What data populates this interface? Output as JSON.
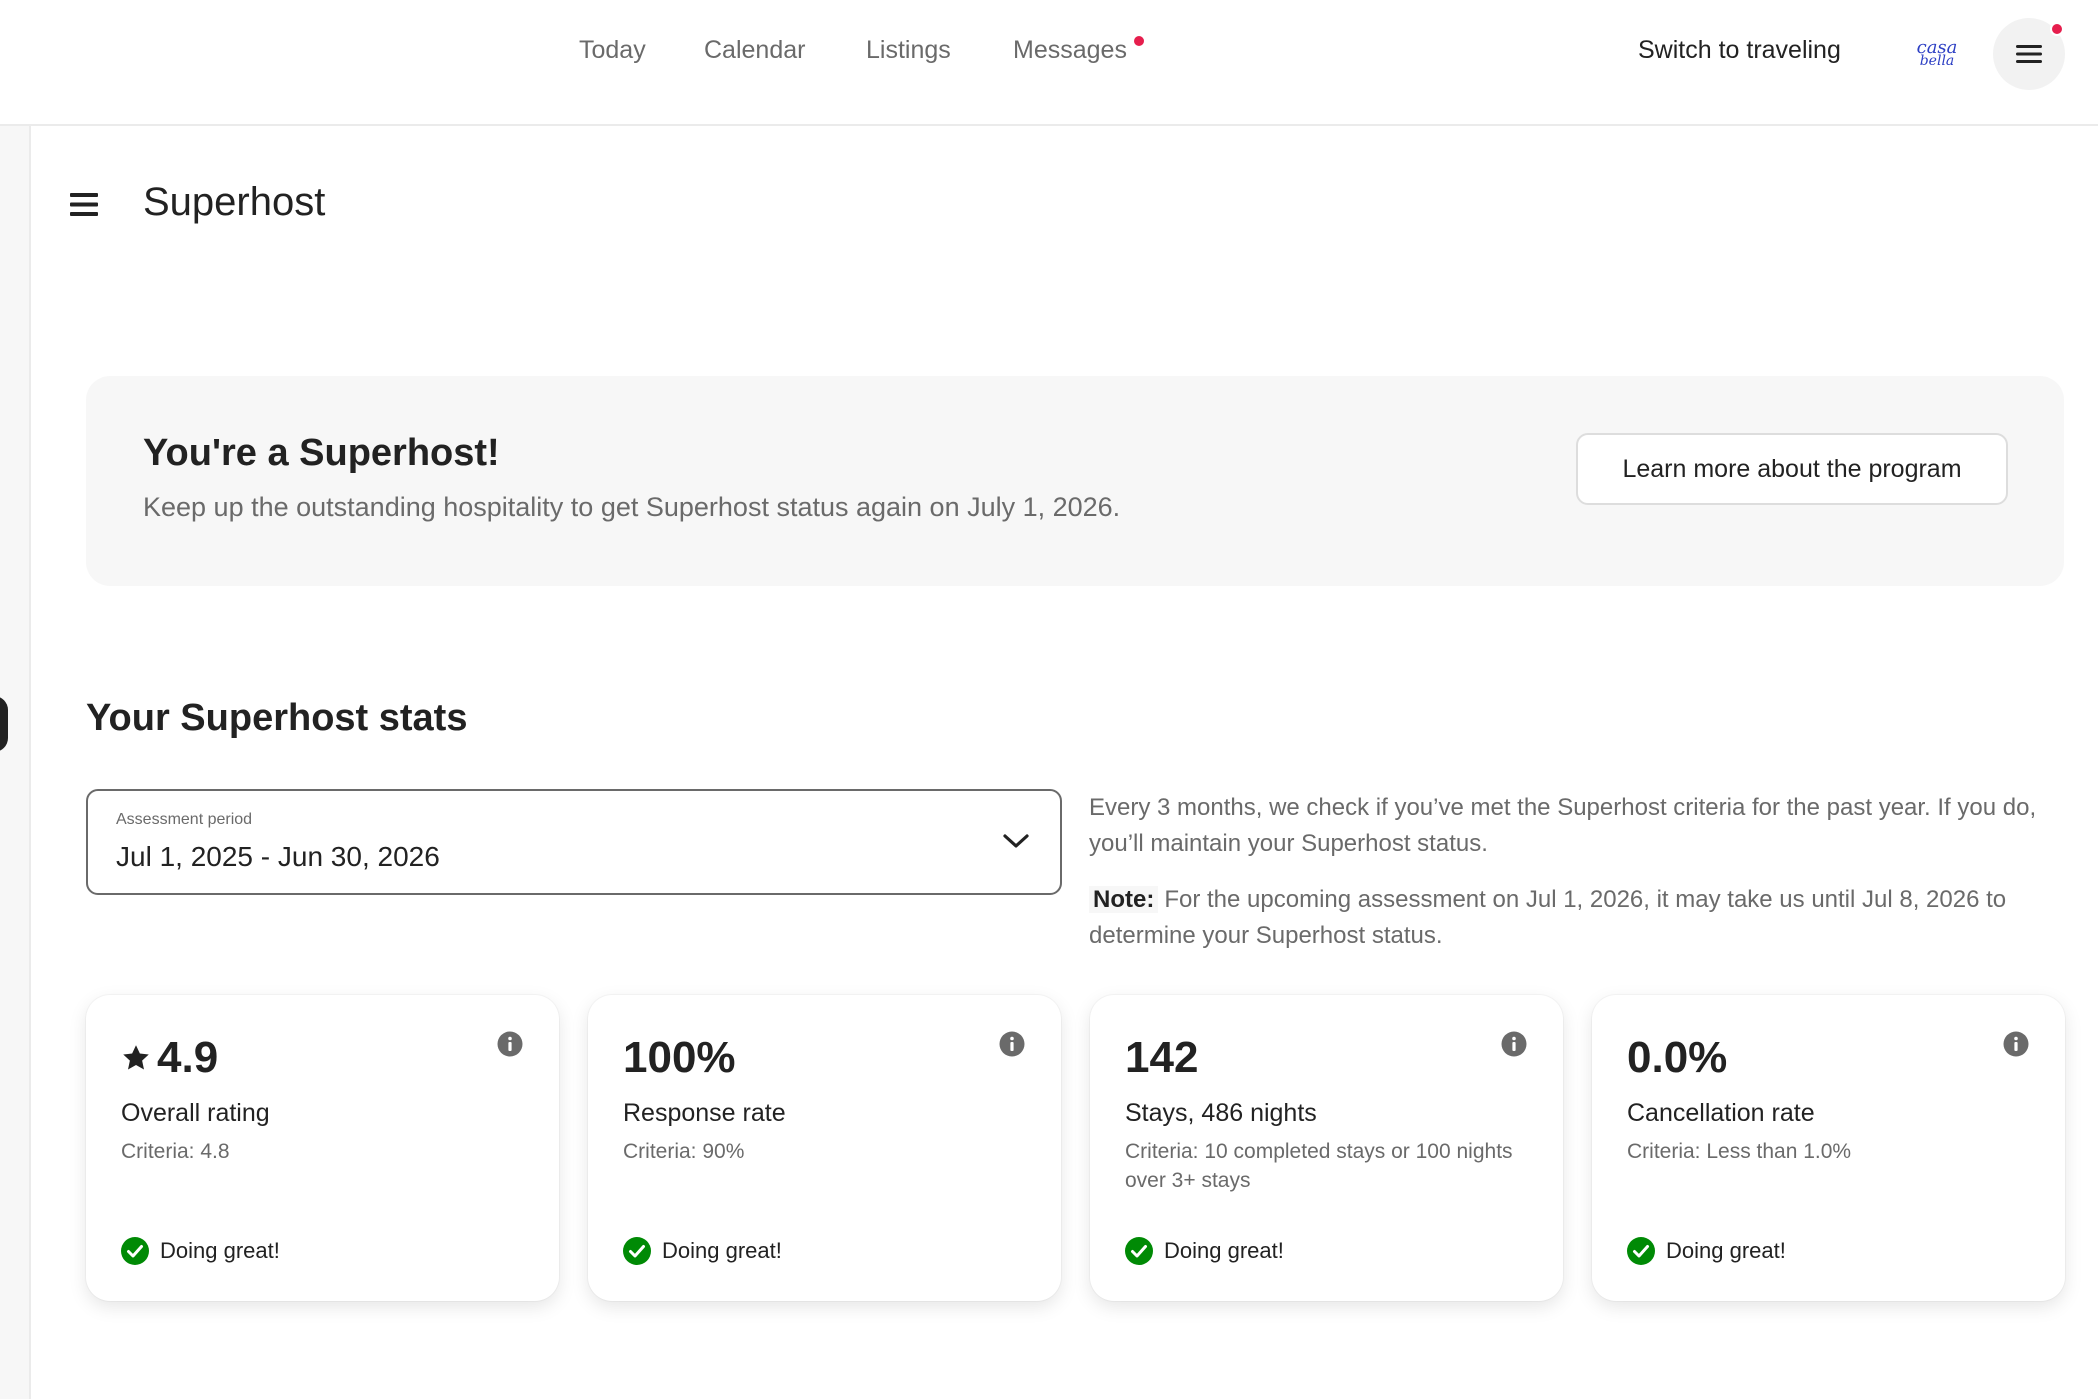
{
  "nav": {
    "items": [
      {
        "label": "Today"
      },
      {
        "label": "Calendar"
      },
      {
        "label": "Listings"
      },
      {
        "label": "Messages"
      }
    ],
    "switch_label": "Switch to traveling",
    "avatar_text_1": "casa",
    "avatar_text_2": "bella",
    "notification_color": "#e61e4d"
  },
  "page": {
    "title": "Superhost"
  },
  "banner": {
    "title": "You're a Superhost!",
    "subtitle": "Keep up the outstanding hospitality to get Superhost status again on July 1, 2026.",
    "button_label": "Learn more about the program"
  },
  "stats": {
    "heading": "Your Superhost stats",
    "period_label": "Assessment period",
    "period_value": "Jul 1, 2025 - Jun 30, 2026",
    "info": "Every 3 months, we check if you’ve met the Superhost criteria for the past year. If you do, you’ll maintain your Superhost status.",
    "note_label": "Note:",
    "note_text": "For the upcoming assessment on Jul 1, 2026, it may take us until Jul 8, 2026 to determine your Superhost status.",
    "cards": [
      {
        "value": "4.9",
        "label": "Overall rating",
        "criteria": "Criteria: 4.8",
        "status": "Doing great!",
        "icon": "star-icon"
      },
      {
        "value": "100%",
        "label": "Response rate",
        "criteria": "Criteria: 90%",
        "status": "Doing great!"
      },
      {
        "value": "142",
        "label": "Stays, 486 nights",
        "criteria": "Criteria: 10 completed stays or 100 nights over 3+ stays",
        "status": "Doing great!"
      },
      {
        "value": "0.0%",
        "label": "Cancellation rate",
        "criteria": "Criteria: Less than 1.0%",
        "status": "Doing great!"
      }
    ],
    "status_color": "#008a05"
  }
}
